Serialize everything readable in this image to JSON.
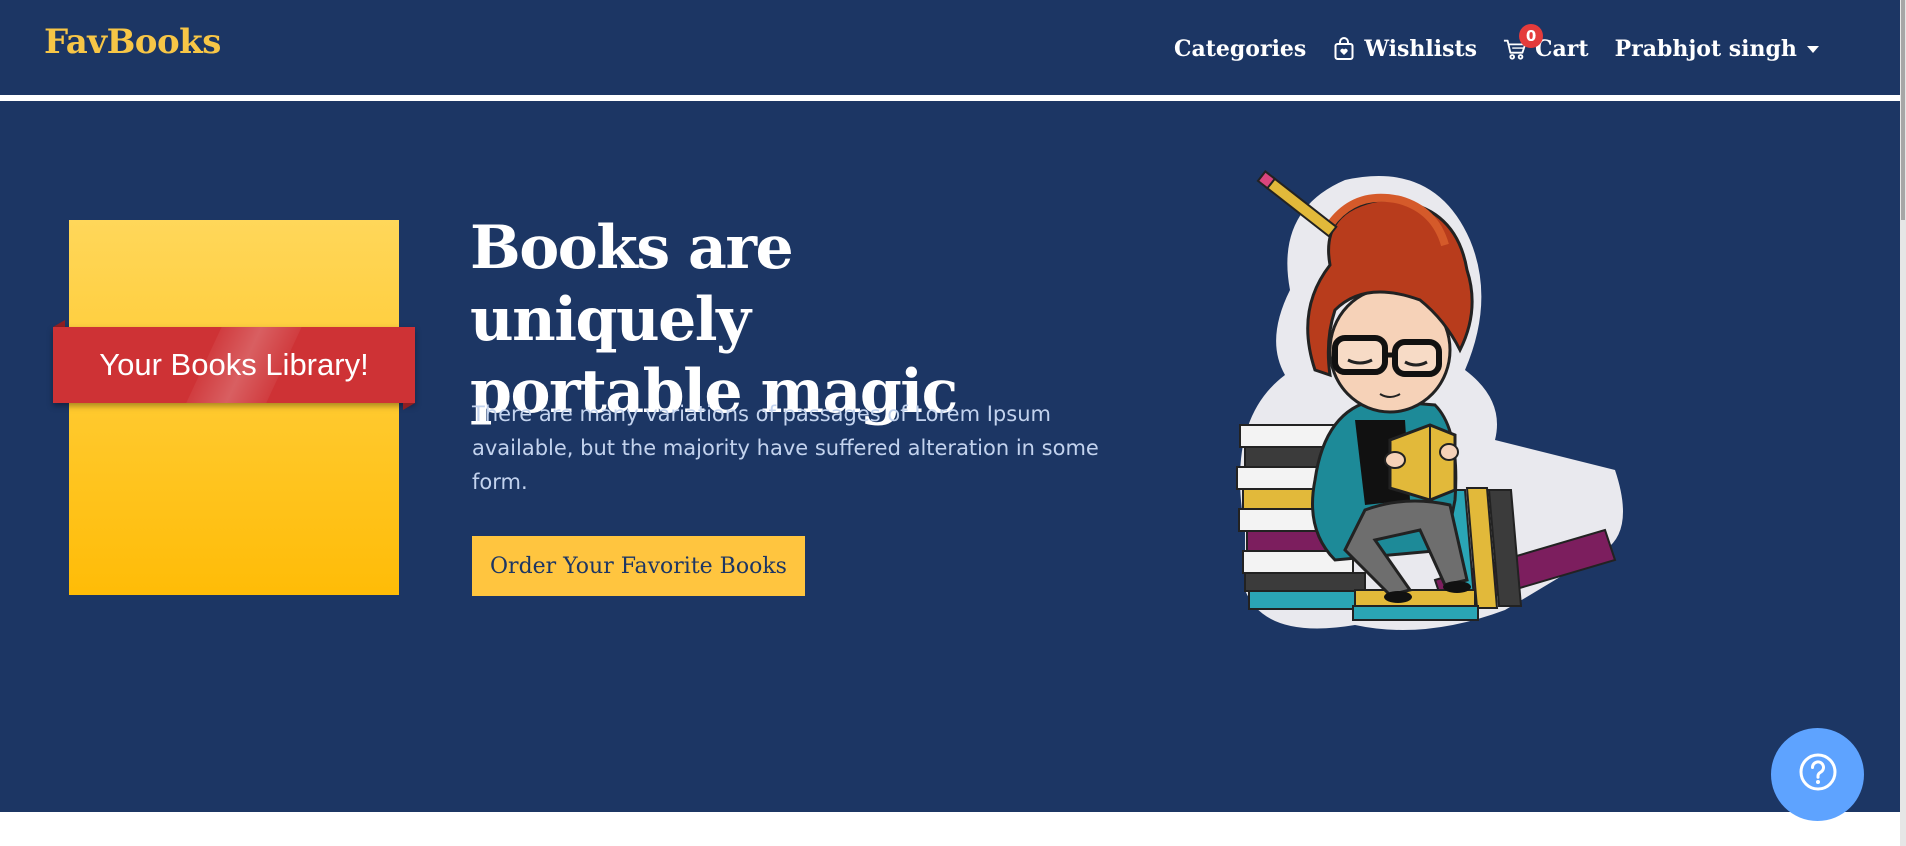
{
  "navbar": {
    "brand": "FavBooks",
    "links": {
      "categories": "Categories",
      "wishlists": "Wishlists",
      "cart": "Cart",
      "cart_count": "0",
      "user": "Prabhjot singh"
    },
    "icons": [
      "bag-icon",
      "cart-icon",
      "caret-down-icon"
    ]
  },
  "hero": {
    "badge_text": "Your Books Library!",
    "headline": "Books are uniquely portable magic",
    "lead": "There are many variations of passages of Lorem Ipsum available, but the majority have suffered alteration in some form.",
    "cta": "Order Your Favorite Books"
  },
  "colors": {
    "background": "#1c3664",
    "brand": "#f7c646",
    "accent": "#ffc53f",
    "ribbon": "#ce3235",
    "help_button": "#5ea3ff"
  },
  "help_icon": "question-circle-icon"
}
